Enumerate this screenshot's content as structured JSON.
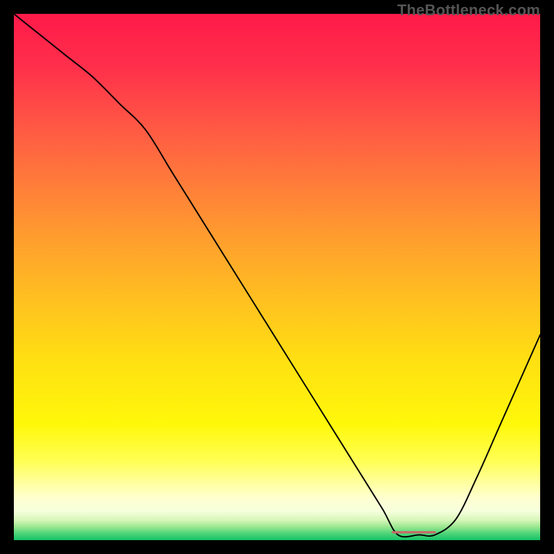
{
  "watermark": "TheBottleneck.com",
  "chart_data": {
    "type": "line",
    "title": "",
    "xlabel": "",
    "ylabel": "",
    "xlim": [
      0,
      100
    ],
    "ylim": [
      0,
      100
    ],
    "grid": false,
    "legend": false,
    "series": [
      {
        "name": "curve",
        "x": [
          0,
          5,
          10,
          15,
          20,
          25,
          30,
          35,
          40,
          45,
          50,
          55,
          60,
          65,
          70,
          73,
          77,
          80,
          84,
          88,
          92,
          96,
          100
        ],
        "values": [
          100,
          96,
          92,
          88,
          83,
          78,
          70,
          62,
          54,
          46,
          38,
          30,
          22,
          14,
          6,
          1,
          1,
          1,
          4,
          12,
          21,
          30,
          39
        ]
      }
    ],
    "annotations": [
      {
        "type": "segment",
        "name": "red-bar",
        "x0": 72,
        "y0": 1.5,
        "x1": 80,
        "y1": 1.5,
        "color": "#c96a6a",
        "lw": 3.2
      }
    ],
    "background_gradient": {
      "stops": [
        {
          "offset": 0.0,
          "color": "#ff1a49"
        },
        {
          "offset": 0.1,
          "color": "#ff2f4b"
        },
        {
          "offset": 0.22,
          "color": "#ff5a44"
        },
        {
          "offset": 0.34,
          "color": "#ff8238"
        },
        {
          "offset": 0.46,
          "color": "#ffa82a"
        },
        {
          "offset": 0.56,
          "color": "#ffc51e"
        },
        {
          "offset": 0.66,
          "color": "#ffe012"
        },
        {
          "offset": 0.78,
          "color": "#fff80a"
        },
        {
          "offset": 0.85,
          "color": "#ffff55"
        },
        {
          "offset": 0.89,
          "color": "#ffff9e"
        },
        {
          "offset": 0.92,
          "color": "#ffffd0"
        },
        {
          "offset": 0.945,
          "color": "#f6ffdc"
        },
        {
          "offset": 0.962,
          "color": "#d6f6b8"
        },
        {
          "offset": 0.975,
          "color": "#99e78f"
        },
        {
          "offset": 0.987,
          "color": "#4fd57a"
        },
        {
          "offset": 1.0,
          "color": "#15c266"
        }
      ]
    },
    "curve_color": "#000000",
    "curve_lw": 2.0
  }
}
